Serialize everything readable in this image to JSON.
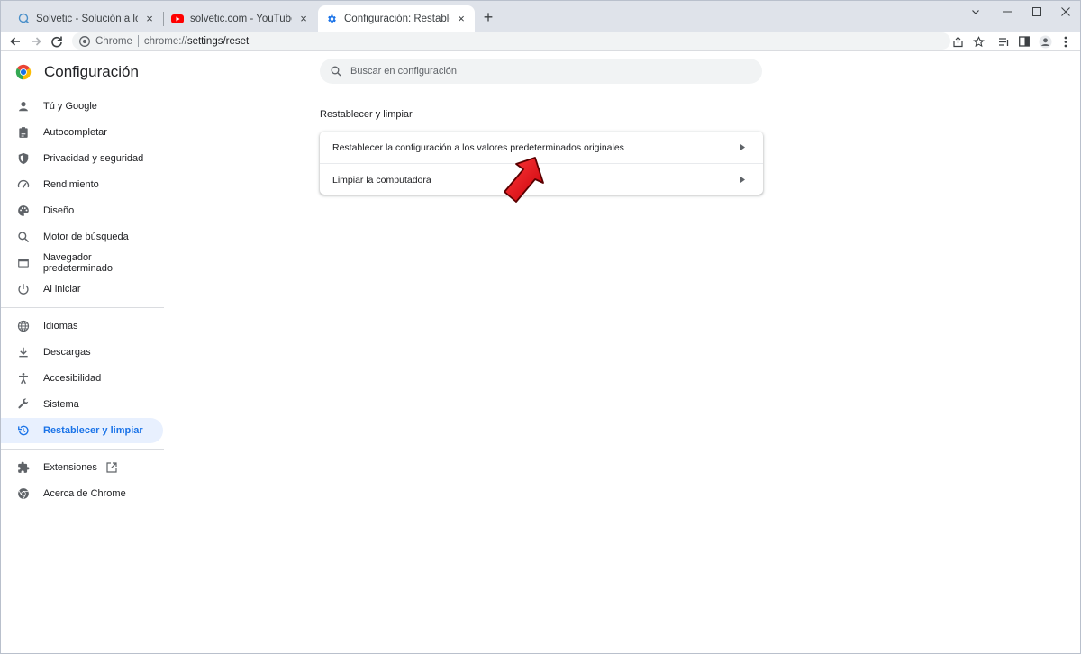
{
  "tabs": [
    {
      "title": "Solvetic - Solución a los problemas",
      "favicon": "solvetic-icon",
      "active": false
    },
    {
      "title": "solvetic.com - YouTube",
      "favicon": "youtube-icon",
      "active": false
    },
    {
      "title": "Configuración: Restablecer y limpiar",
      "favicon": "gear-icon",
      "active": true
    }
  ],
  "toolbar": {
    "chip": "Chrome",
    "url_scheme": "chrome://",
    "url_path": "settings/reset"
  },
  "page": {
    "brand": "Configuración",
    "search_placeholder": "Buscar en configuración",
    "section_title": "Restablecer y limpiar",
    "rows": [
      {
        "label": "Restablecer la configuración a los valores predeterminados originales"
      },
      {
        "label": "Limpiar la computadora"
      }
    ]
  },
  "nav": {
    "items": [
      {
        "label": "Tú y Google",
        "icon": "person-icon"
      },
      {
        "label": "Autocompletar",
        "icon": "clipboard-icon"
      },
      {
        "label": "Privacidad y seguridad",
        "icon": "shield-icon"
      },
      {
        "label": "Rendimiento",
        "icon": "speedometer-icon"
      },
      {
        "label": "Diseño",
        "icon": "palette-icon"
      },
      {
        "label": "Motor de búsqueda",
        "icon": "search-icon"
      },
      {
        "label": "Navegador predeterminado",
        "icon": "browser-icon"
      },
      {
        "label": "Al iniciar",
        "icon": "power-icon"
      },
      {
        "label": "Idiomas",
        "icon": "globe-icon"
      },
      {
        "label": "Descargas",
        "icon": "download-icon"
      },
      {
        "label": "Accesibilidad",
        "icon": "accessibility-icon"
      },
      {
        "label": "Sistema",
        "icon": "wrench-icon"
      },
      {
        "label": "Restablecer y limpiar",
        "icon": "restore-icon",
        "selected": true
      },
      {
        "label": "Extensiones",
        "icon": "puzzle-icon"
      },
      {
        "label": "Acerca de Chrome",
        "icon": "chrome-icon"
      }
    ]
  },
  "colors": {
    "accent": "#1a73e8",
    "selected_bg": "#e8f0fe",
    "pointer": "#e8131b"
  }
}
